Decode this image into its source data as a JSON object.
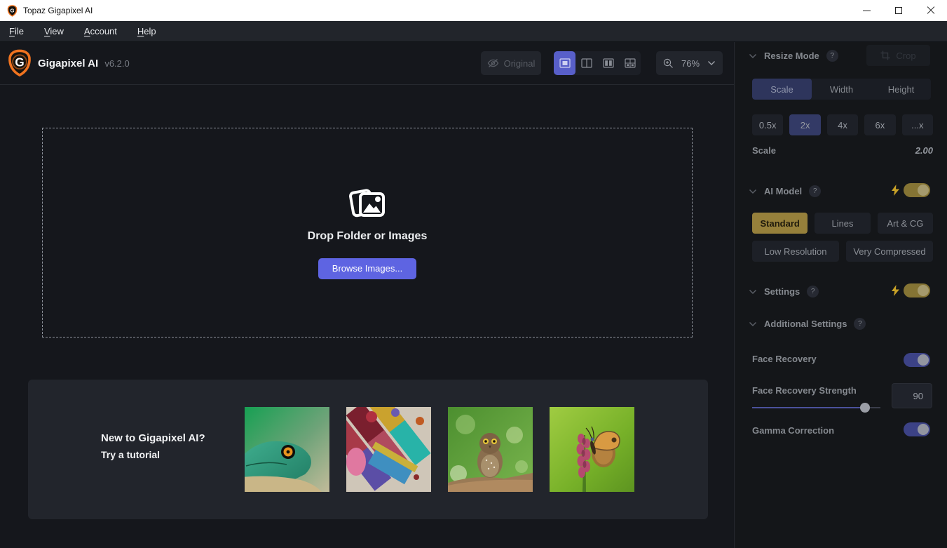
{
  "window": {
    "title": "Topaz Gigapixel AI"
  },
  "menu": {
    "items": [
      {
        "label": "File"
      },
      {
        "label": "View"
      },
      {
        "label": "Account"
      },
      {
        "label": "Help"
      }
    ]
  },
  "header": {
    "app_name": "Gigapixel AI",
    "version": "v6.2.0",
    "original_label": "Original",
    "zoom_value": "76%"
  },
  "dropzone": {
    "title": "Drop Folder or Images",
    "browse_label": "Browse Images..."
  },
  "tutorial": {
    "heading": "New to Gigapixel AI?",
    "subheading": "Try a tutorial",
    "thumbnails": [
      "lizard",
      "paintbrushes",
      "owl",
      "butterfly"
    ]
  },
  "sidebar": {
    "resize": {
      "title": "Resize Mode",
      "help": "?",
      "crop_label": "Crop",
      "tabs": [
        "Scale",
        "Width",
        "Height"
      ],
      "active_tab": "Scale",
      "presets": [
        "0.5x",
        "2x",
        "4x",
        "6x",
        "...x"
      ],
      "active_preset": "2x",
      "scale_label": "Scale",
      "scale_value": "2.00"
    },
    "ai_model": {
      "title": "AI Model",
      "help": "?",
      "models": [
        "Standard",
        "Lines",
        "Art & CG",
        "Low Resolution",
        "Very Compressed"
      ],
      "active_model": "Standard",
      "auto_on": true
    },
    "settings": {
      "title": "Settings",
      "help": "?",
      "auto_on": true
    },
    "additional": {
      "title": "Additional Settings",
      "help": "?",
      "face_recovery_label": "Face Recovery",
      "face_recovery_on": true,
      "strength_label": "Face Recovery Strength",
      "strength_value": "90",
      "gamma_label": "Gamma Correction",
      "gamma_on": true
    }
  },
  "colors": {
    "accent_indigo": "#5e64e2",
    "selected_indigo": "#333a66",
    "model_gold": "#96803b",
    "logo_orange": "#f0731f",
    "panel_bg": "#15171c"
  }
}
